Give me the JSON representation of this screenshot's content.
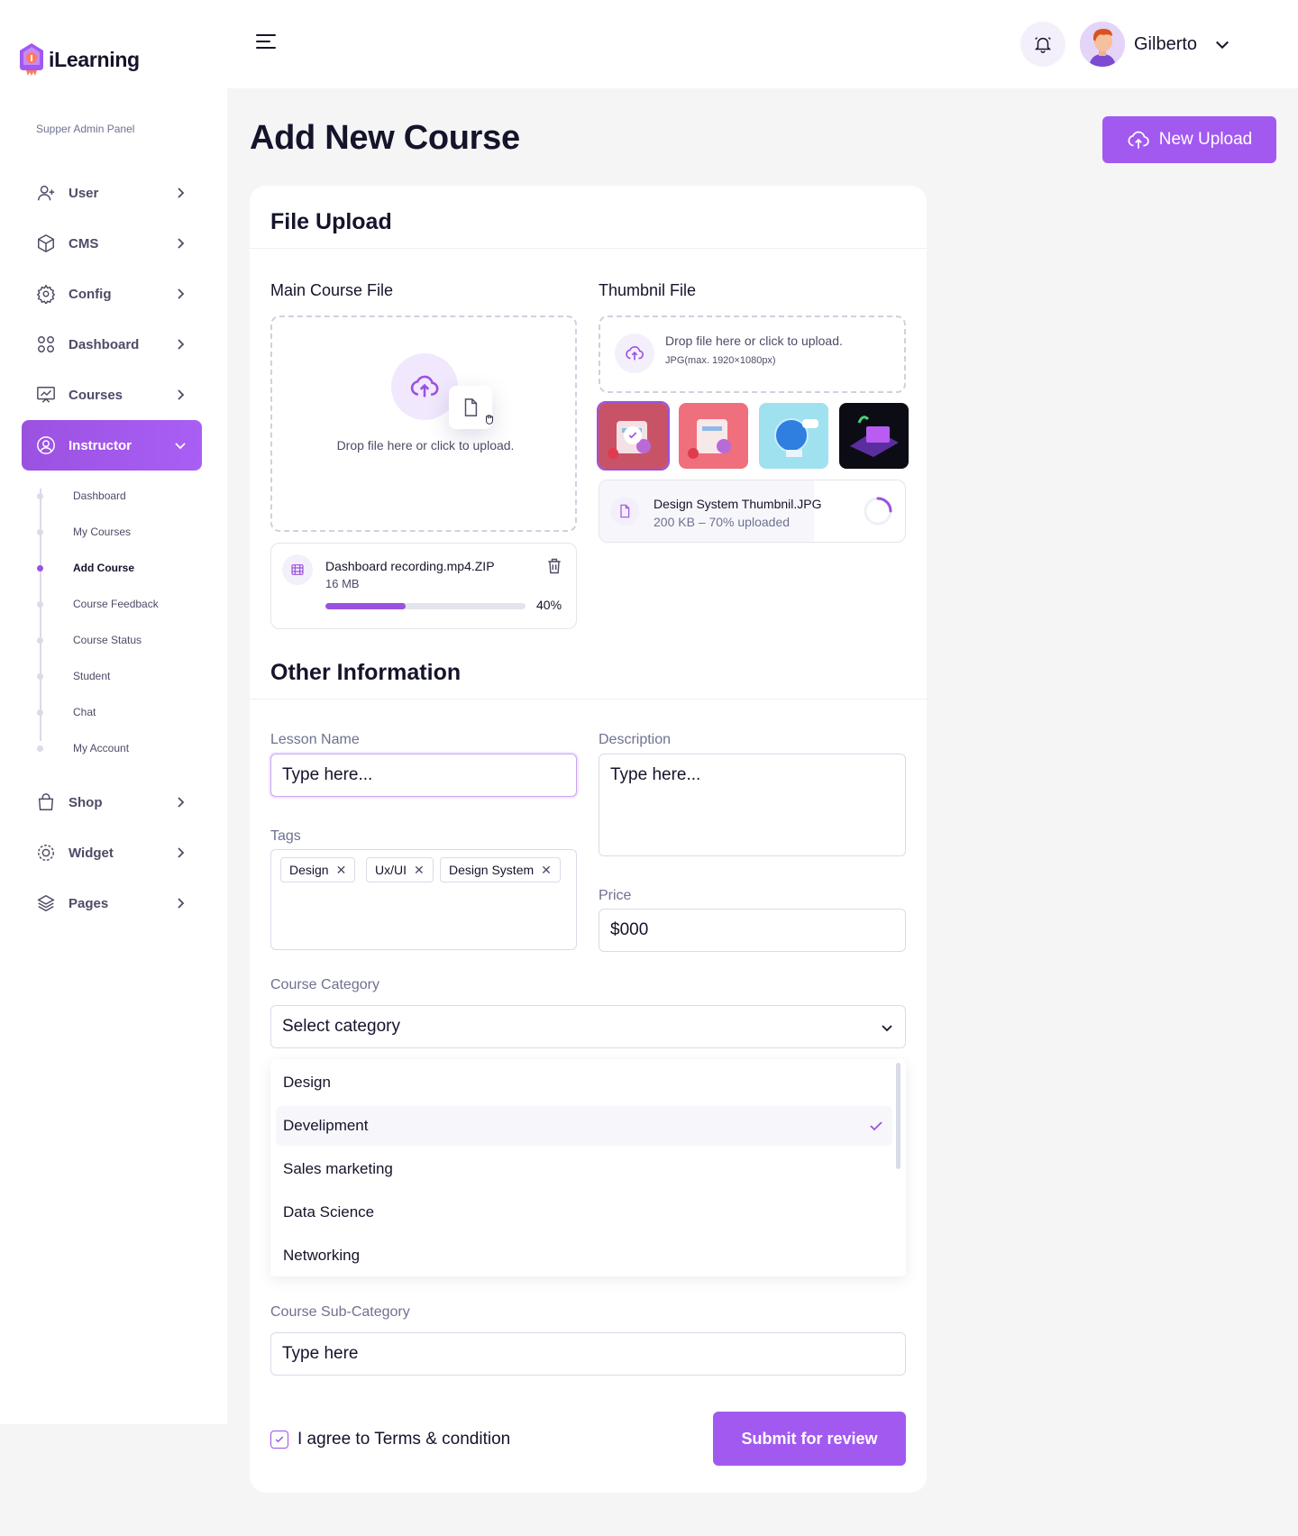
{
  "brand": {
    "name": "iLearning",
    "panel_label": "Supper Admin Panel"
  },
  "sidebar": {
    "items": [
      {
        "label": "User",
        "icon": "user-add-icon"
      },
      {
        "label": "CMS",
        "icon": "box-icon"
      },
      {
        "label": "Config",
        "icon": "gear-icon"
      },
      {
        "label": "Dashboard",
        "icon": "grid-icon"
      },
      {
        "label": "Courses",
        "icon": "presentation-icon"
      },
      {
        "label": "Instructor",
        "icon": "user-circle-icon"
      }
    ],
    "instructor_sub": [
      {
        "label": "Dashboard"
      },
      {
        "label": "My Courses"
      },
      {
        "label": "Add Course"
      },
      {
        "label": "Course Feedback"
      },
      {
        "label": "Course Status"
      },
      {
        "label": "Student"
      },
      {
        "label": "Chat"
      },
      {
        "label": "My Account"
      }
    ],
    "items_after": [
      {
        "label": "Shop",
        "icon": "bag-icon"
      },
      {
        "label": "Widget",
        "icon": "widget-gear-icon"
      },
      {
        "label": "Pages",
        "icon": "layers-icon"
      }
    ],
    "active_item": "Instructor",
    "active_sub": "Add Course"
  },
  "header": {
    "user_name": "Gilberto"
  },
  "page": {
    "title": "Add New Course",
    "new_upload_label": "New Upload"
  },
  "file_upload": {
    "title": "File Upload",
    "main": {
      "label": "Main Course File",
      "drop_text": "Drop file here or click to upload.",
      "file_name": "Dashboard recording.mp4.ZIP",
      "file_size": "16 MB",
      "progress_pct": 40,
      "progress_label": "40%"
    },
    "thumb": {
      "label": "Thumbnil File",
      "drop_text": "Drop file here or click to upload.",
      "drop_sub": "JPG(max. 1920×1080px)",
      "file_name": "Design System Thumbnil.JPG",
      "file_sub": "200 KB – 70% uploaded",
      "progress_pct": 70
    }
  },
  "other": {
    "title": "Other Information",
    "lesson_label": "Lesson Name",
    "lesson_placeholder": "Type here...",
    "description_label": "Description",
    "description_placeholder": "Type here...",
    "tags_label": "Tags",
    "tags": [
      "Design",
      "Ux/UI",
      "Design System"
    ],
    "price_label": "Price",
    "price_value": "$000",
    "category_label": "Course Category",
    "category_placeholder": "Select category",
    "category_options": [
      "Design",
      "Develipment",
      "Sales marketing",
      "Data Science",
      "Networking"
    ],
    "category_selected": "Develipment",
    "subcategory_label": "Course Sub-Category",
    "subcategory_placeholder": "Type here",
    "agree_label": "I agree to Terms & condition",
    "submit_label": "Submit for review"
  },
  "colors": {
    "accent": "#a259f0",
    "text": "#14142b",
    "muted": "#6e7191"
  }
}
